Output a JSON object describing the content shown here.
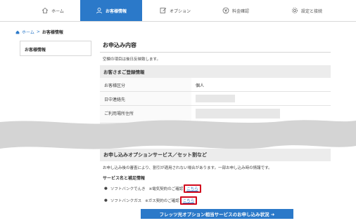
{
  "nav": {
    "tabs": [
      {
        "label": "ホーム",
        "icon": "home-icon"
      },
      {
        "label": "お客様情報",
        "icon": "user-icon"
      },
      {
        "label": "オプション",
        "icon": "edit-icon"
      },
      {
        "label": "料金確認",
        "icon": "yen-icon"
      },
      {
        "label": "設定と接続",
        "icon": "gear-icon"
      }
    ],
    "active_color": "#2b79c9"
  },
  "breadcrumb": {
    "home": "ホーム",
    "separator": ">",
    "current": "お客様情報"
  },
  "sidebar": {
    "item": "お客様情報"
  },
  "main": {
    "title": "お申込み内容",
    "note": "空欄の項目は後日反映致します。",
    "registration": {
      "heading": "お客さまご登録情報",
      "rows": [
        {
          "label": "お客様区分",
          "value": "個人"
        },
        {
          "label": "日中連絡先",
          "value": ""
        },
        {
          "label": "ご利用場所住所",
          "value": ""
        }
      ]
    },
    "options": {
      "heading": "お申し込みオプションサービス／セット割など",
      "warning": "お申し込み後の審査により、割引が適用されない場合があります。一部お申し込み時の情報です。",
      "service_head": "サービス名と補足情報",
      "items": [
        {
          "name": "ソフトバンクでんき",
          "note": "※電気契約のご確認",
          "link": "こちら"
        },
        {
          "name": "ソフトバンクガス",
          "note": "※ガス契約のご確認",
          "link": "こちら"
        }
      ]
    },
    "cta_button": "フレッツ光オプション相当サービスのお申し込み状況 ➜"
  },
  "colors": {
    "highlight": "#d20a1e",
    "link": "#2b79c9"
  }
}
